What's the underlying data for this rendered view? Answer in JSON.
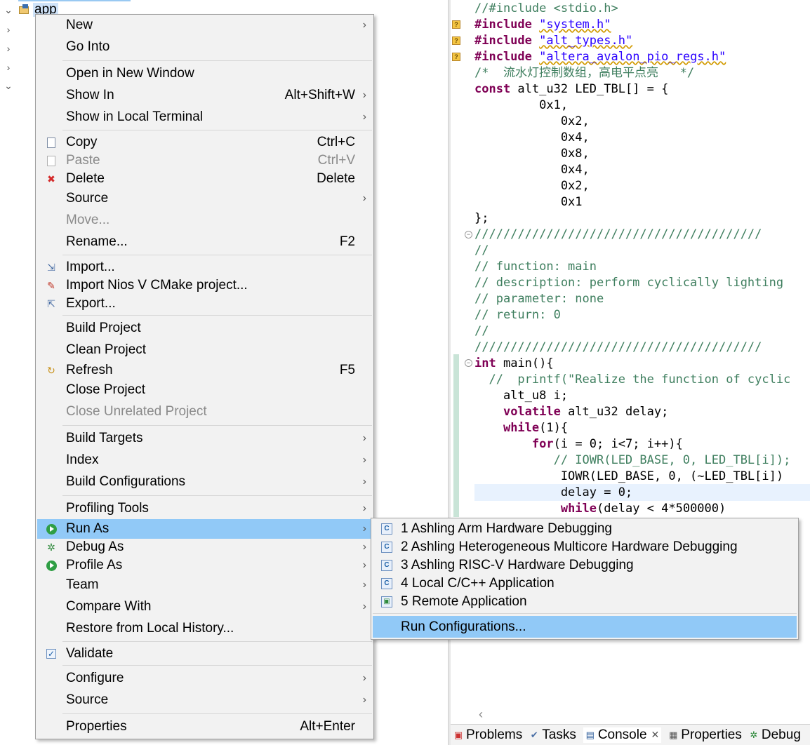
{
  "tree": {
    "app_label": "app",
    "toggles": [
      "⌄",
      "›",
      "›",
      "›",
      "⌄"
    ]
  },
  "editor": {
    "lines": [
      {
        "t": "//#include <stdio.h>",
        "c": "cm"
      },
      {
        "t": "#include \"system.h\"",
        "c": "inc"
      },
      {
        "t": "#include \"alt_types.h\"",
        "c": "inc"
      },
      {
        "t": "#include \"altera_avalon_pio_regs.h\"",
        "c": "inc"
      },
      {
        "t": "/*  流水灯控制数组，高电平点亮   */",
        "c": "cm"
      },
      {
        "t": "const alt_u32 LED_TBL[] = {",
        "c": "const"
      },
      {
        "t": "         0x1,",
        "c": ""
      },
      {
        "t": "            0x2,",
        "c": ""
      },
      {
        "t": "            0x4,",
        "c": ""
      },
      {
        "t": "            0x8,",
        "c": ""
      },
      {
        "t": "            0x4,",
        "c": ""
      },
      {
        "t": "            0x2,",
        "c": ""
      },
      {
        "t": "            0x1",
        "c": ""
      },
      {
        "t": "};",
        "c": ""
      },
      {
        "t": "////////////////////////////////////////",
        "c": "cm"
      },
      {
        "t": "//",
        "c": "cm"
      },
      {
        "t": "// function: main",
        "c": "cm"
      },
      {
        "t": "// description: perform cyclically lighting",
        "c": "cm"
      },
      {
        "t": "// parameter: none",
        "c": "cm"
      },
      {
        "t": "// return: 0",
        "c": "cm"
      },
      {
        "t": "//",
        "c": "cm"
      },
      {
        "t": "////////////////////////////////////////",
        "c": "cm"
      },
      {
        "t": "int main(){",
        "c": "int"
      },
      {
        "t": "  //  printf(\"Realize the function of cyclic",
        "c": "cm"
      },
      {
        "t": "    alt_u8 i;",
        "c": ""
      },
      {
        "t": "    volatile alt_u32 delay;",
        "c": "volatile"
      },
      {
        "t": "    while(1){",
        "c": "while"
      },
      {
        "t": "        for(i = 0; i<7; i++){",
        "c": "for"
      },
      {
        "t": "           // IOWR(LED_BASE, 0, LED_TBL[i]);",
        "c": "cm"
      },
      {
        "t": "            IOWR(LED_BASE, 0, (~LED_TBL[i])",
        "c": ""
      },
      {
        "t": "            delay = 0;",
        "c": ""
      },
      {
        "t": "            while(delay < 4*500000)",
        "c": "while2"
      }
    ]
  },
  "context_menu": {
    "items": [
      {
        "label": "New",
        "sub": true
      },
      {
        "label": "Go Into"
      },
      {
        "label": "Open in New Window"
      },
      {
        "label": "Show In",
        "accel": "Alt+Shift+W",
        "sub": true
      },
      {
        "label": "Show in Local Terminal",
        "sub": true
      },
      {
        "label": "Copy",
        "accel": "Ctrl+C",
        "icon": "copy-icon"
      },
      {
        "label": "Paste",
        "accel": "Ctrl+V",
        "icon": "paste-icon",
        "disabled": true
      },
      {
        "label": "Delete",
        "accel": "Delete",
        "icon": "delete-icon"
      },
      {
        "label": "Source",
        "sub": true
      },
      {
        "label": "Move...",
        "disabled": true
      },
      {
        "label": "Rename...",
        "accel": "F2"
      },
      {
        "label": "Import...",
        "icon": "import-icon"
      },
      {
        "label": "Import Nios V CMake project...",
        "icon": "nios-import-icon"
      },
      {
        "label": "Export...",
        "icon": "export-icon"
      },
      {
        "label": "Build Project"
      },
      {
        "label": "Clean Project"
      },
      {
        "label": "Refresh",
        "accel": "F5",
        "icon": "refresh-icon"
      },
      {
        "label": "Close Project"
      },
      {
        "label": "Close Unrelated Project",
        "disabled": true
      },
      {
        "label": "Build Targets",
        "sub": true
      },
      {
        "label": "Index",
        "sub": true
      },
      {
        "label": "Build Configurations",
        "sub": true
      },
      {
        "label": "Profiling Tools",
        "sub": true
      },
      {
        "label": "Run As",
        "sub": true,
        "icon": "run-icon",
        "hover": true
      },
      {
        "label": "Debug As",
        "sub": true,
        "icon": "debug-icon"
      },
      {
        "label": "Profile As",
        "sub": true,
        "icon": "profile-icon"
      },
      {
        "label": "Team",
        "sub": true
      },
      {
        "label": "Compare With",
        "sub": true
      },
      {
        "label": "Restore from Local History..."
      },
      {
        "label": "Validate",
        "icon": "checkbox-icon"
      },
      {
        "label": "Configure",
        "sub": true
      },
      {
        "label": "Source",
        "sub": true
      },
      {
        "label": "Properties",
        "accel": "Alt+Enter"
      }
    ]
  },
  "run_as_submenu": {
    "items": [
      {
        "label": "1 Ashling Arm Hardware Debugging",
        "icon": "c-launch-icon"
      },
      {
        "label": "2 Ashling Heterogeneous Multicore Hardware Debugging",
        "icon": "c-launch-icon"
      },
      {
        "label": "3 Ashling RISC-V Hardware Debugging",
        "icon": "c-launch-icon"
      },
      {
        "label": "4 Local C/C++ Application",
        "icon": "c-launch-icon"
      },
      {
        "label": "5 Remote Application",
        "icon": "remote-app-icon"
      },
      {
        "label": "Run Configurations...",
        "hover": true
      }
    ]
  },
  "bottom_tabs": [
    {
      "label": "Problems",
      "icon": "problems-icon"
    },
    {
      "label": "Tasks",
      "icon": "tasks-icon"
    },
    {
      "label": "Console",
      "icon": "console-icon",
      "active": true
    },
    {
      "label": "Properties",
      "icon": "properties-icon"
    },
    {
      "label": "Debug",
      "icon": "debug-icon"
    }
  ],
  "colors": {
    "menu_bg": "#f2f2f2",
    "hover": "#91c9f7",
    "comment": "#3f7f5f",
    "keyword": "#7f0055",
    "string": "#2a00ff"
  }
}
